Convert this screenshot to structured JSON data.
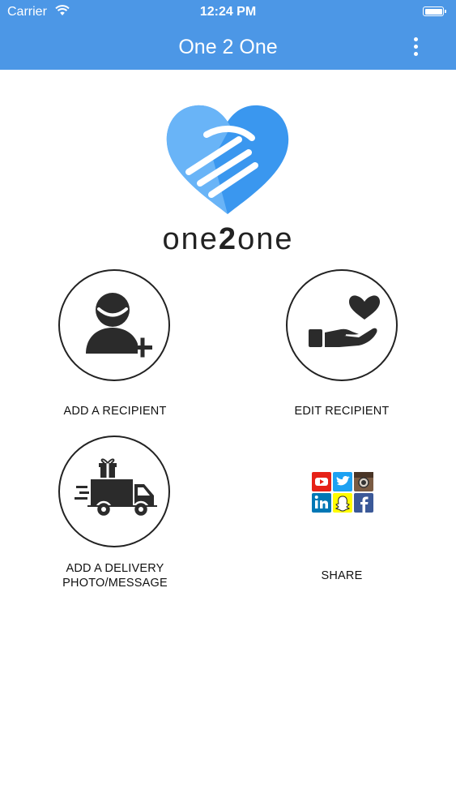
{
  "status_bar": {
    "carrier": "Carrier",
    "time": "12:24 PM"
  },
  "nav": {
    "title": "One 2 One",
    "menu_icon": "more-vertical-icon"
  },
  "logo": {
    "word_before": "one",
    "word_number": "2",
    "word_after": "one",
    "icon": "heart-handshake-logo"
  },
  "actions": {
    "add_recipient": {
      "label": "ADD A RECIPIENT",
      "icon": "add-person-icon"
    },
    "edit_recipient": {
      "label": "EDIT RECIPIENT",
      "icon": "heart-in-hand-icon"
    },
    "add_delivery": {
      "label_line1": "ADD A DELIVERY",
      "label_line2": "PHOTO/MESSAGE",
      "icon": "delivery-van-icon"
    },
    "share": {
      "label": "SHARE",
      "icon": "social-media-grid-icon"
    }
  },
  "colors": {
    "nav_background": "#4c97e6",
    "logo_blue_light": "#62b0f6",
    "logo_blue_dark": "#2d8fee",
    "icon_dark": "#2b2b2b"
  }
}
